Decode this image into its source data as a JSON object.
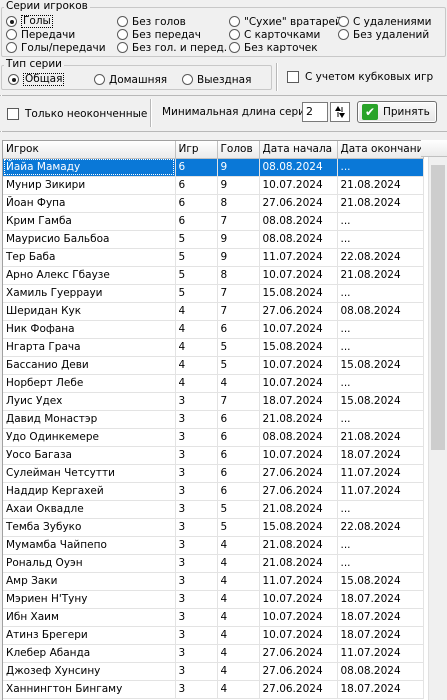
{
  "series_group": {
    "legend": "Серии игроков",
    "options": [
      {
        "label": "Голы",
        "checked": true
      },
      {
        "label": "Передачи",
        "checked": false
      },
      {
        "label": "Голы/передачи",
        "checked": false
      },
      {
        "label": "Без голов",
        "checked": false
      },
      {
        "label": "Без передач",
        "checked": false
      },
      {
        "label": "Без гол. и перед.",
        "checked": false
      },
      {
        "label": "\"Сухие\" вратарей",
        "checked": false
      },
      {
        "label": "С карточками",
        "checked": false
      },
      {
        "label": "Без карточек",
        "checked": false
      },
      {
        "label": "С удалениями",
        "checked": false
      },
      {
        "label": "Без удалений",
        "checked": false
      }
    ]
  },
  "type_group": {
    "legend": "Тип серии",
    "options": [
      {
        "label": "Общая",
        "checked": true
      },
      {
        "label": "Домашняя",
        "checked": false
      },
      {
        "label": "Выездная",
        "checked": false
      }
    ]
  },
  "cup_games_checkbox": {
    "label": "С учетом кубковых игр",
    "checked": false
  },
  "unfinished_checkbox": {
    "label": "Только неоконченные",
    "checked": false
  },
  "min_length": {
    "label": "Минимальная длина серии",
    "value": "2"
  },
  "apply_button": {
    "label": "Принять"
  },
  "table": {
    "columns": [
      "Игрок",
      "Игр",
      "Голов",
      "Дата начала",
      "Дата окончания"
    ],
    "selected_row": 0,
    "rows": [
      [
        "Йайа Мамаду",
        "6",
        "9",
        "08.08.2024",
        "..."
      ],
      [
        "Мунир Зикири",
        "6",
        "9",
        "10.07.2024",
        "21.08.2024"
      ],
      [
        "Йоан Фупа",
        "6",
        "8",
        "27.06.2024",
        "21.08.2024"
      ],
      [
        "Крим Гамба",
        "6",
        "7",
        "08.08.2024",
        "..."
      ],
      [
        "Маурисио Бальбоа",
        "5",
        "9",
        "08.08.2024",
        "..."
      ],
      [
        "Тер Баба",
        "5",
        "9",
        "11.07.2024",
        "22.08.2024"
      ],
      [
        "Арно Алекс Гбаузе",
        "5",
        "8",
        "10.07.2024",
        "21.08.2024"
      ],
      [
        "Хамиль Гуеррауи",
        "5",
        "7",
        "15.08.2024",
        "..."
      ],
      [
        "Шеридан Кук",
        "4",
        "7",
        "27.06.2024",
        "08.08.2024"
      ],
      [
        "Ник Фофана",
        "4",
        "6",
        "10.07.2024",
        "..."
      ],
      [
        "Нгарта Грача",
        "4",
        "5",
        "15.08.2024",
        "..."
      ],
      [
        "Бассанио Деви",
        "4",
        "5",
        "10.07.2024",
        "15.08.2024"
      ],
      [
        "Норберт Лебе",
        "4",
        "4",
        "10.07.2024",
        "..."
      ],
      [
        "Луис Удех",
        "3",
        "7",
        "18.07.2024",
        "15.08.2024"
      ],
      [
        "Давид Монастэр",
        "3",
        "6",
        "21.08.2024",
        "..."
      ],
      [
        "Удо Одинкемере",
        "3",
        "6",
        "08.08.2024",
        "21.08.2024"
      ],
      [
        "Уосо Багаза",
        "3",
        "6",
        "10.07.2024",
        "18.07.2024"
      ],
      [
        "Сулейман Четсутти",
        "3",
        "6",
        "27.06.2024",
        "11.07.2024"
      ],
      [
        "Наддир Кергахей",
        "3",
        "6",
        "27.06.2024",
        "11.07.2024"
      ],
      [
        "Ахаи Оквадле",
        "3",
        "5",
        "21.08.2024",
        "..."
      ],
      [
        "Темба Зубуко",
        "3",
        "5",
        "15.08.2024",
        "22.08.2024"
      ],
      [
        "Мумамба Чайпепо",
        "3",
        "4",
        "21.08.2024",
        "..."
      ],
      [
        "Рональд Оуэн",
        "3",
        "4",
        "21.08.2024",
        "..."
      ],
      [
        "Амр Заки",
        "3",
        "4",
        "11.07.2024",
        "15.08.2024"
      ],
      [
        "Мэриен Н'Туну",
        "3",
        "4",
        "10.07.2024",
        "18.07.2024"
      ],
      [
        "Ибн Хаим",
        "3",
        "4",
        "10.07.2024",
        "18.07.2024"
      ],
      [
        "Атинз Брегери",
        "3",
        "4",
        "10.07.2024",
        "18.07.2024"
      ],
      [
        "Клебер Абанда",
        "3",
        "4",
        "27.06.2024",
        "11.07.2024"
      ],
      [
        "Джозеф Хунсину",
        "3",
        "4",
        "27.06.2024",
        "08.08.2024"
      ],
      [
        "Ханнингтон Бингаму",
        "3",
        "4",
        "27.06.2024",
        "18.07.2024"
      ]
    ]
  }
}
